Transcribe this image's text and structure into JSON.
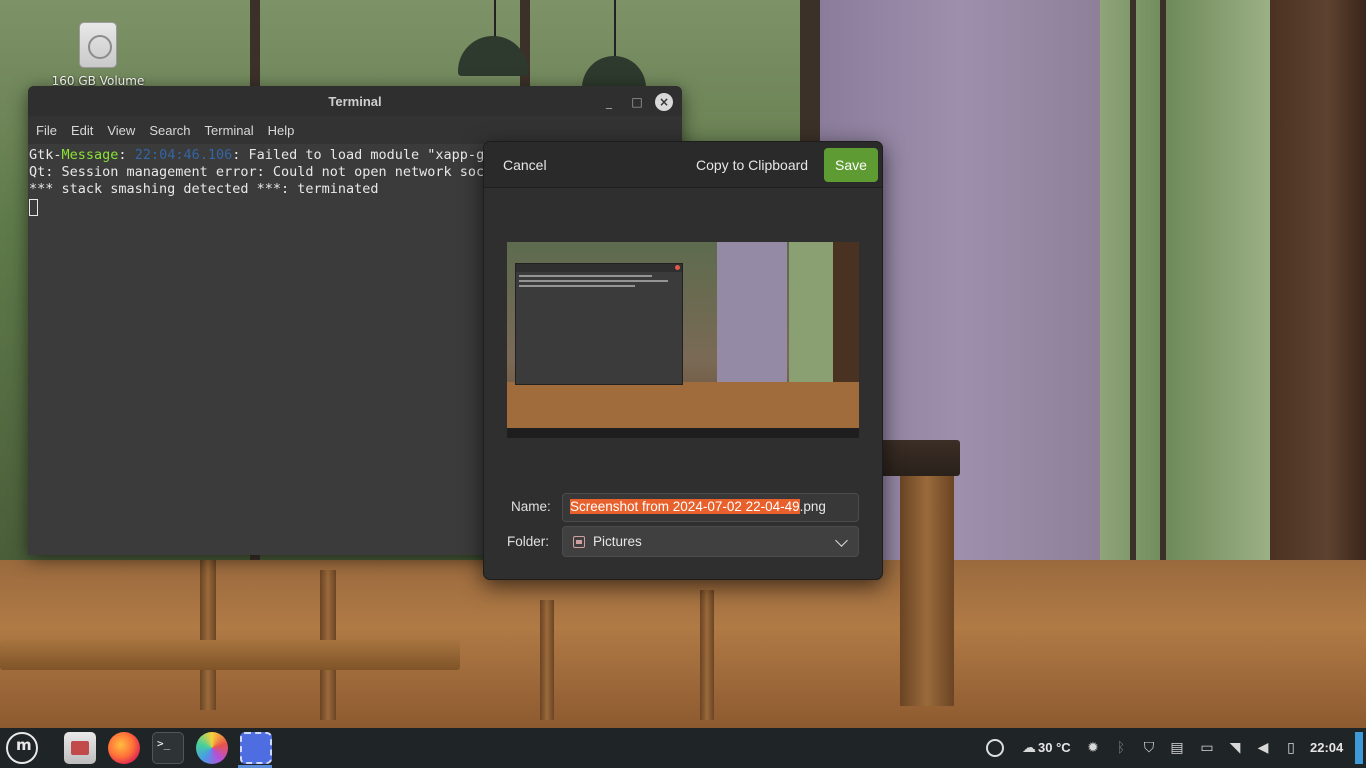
{
  "desktop": {
    "icon_label": "160 GB Volume"
  },
  "terminal": {
    "title": "Terminal",
    "menu": [
      "File",
      "Edit",
      "View",
      "Search",
      "Terminal",
      "Help"
    ],
    "lines": {
      "l1_prefix": "Gtk-",
      "l1_message": "Message",
      "l1_colon": ": ",
      "l1_time": "22:04:46.106",
      "l1_rest": ": Failed to load module \"xapp-gtk",
      "l2": "Qt: Session management error: Could not open network sock",
      "l3": "*** stack smashing detected ***: terminated"
    }
  },
  "screenshot_dialog": {
    "cancel_label": "Cancel",
    "copy_label": "Copy to Clipboard",
    "save_label": "Save",
    "name_label": "Name:",
    "name_selected": "Screenshot from 2024-07-02 22-04-49",
    "name_ext": ".png",
    "folder_label": "Folder:",
    "folder_value": "Pictures"
  },
  "taskbar": {
    "apps": [
      "menu-icon",
      "files-icon",
      "firefox-icon",
      "terminal-icon",
      "color-picker-icon",
      "screenshot-icon"
    ],
    "weather": "30 °C",
    "clock": "22:04"
  },
  "colors": {
    "save_button": "#5e9c33",
    "selection": "#e8612c",
    "terminal_green": "#8ae234",
    "terminal_blue": "#3465a4"
  }
}
